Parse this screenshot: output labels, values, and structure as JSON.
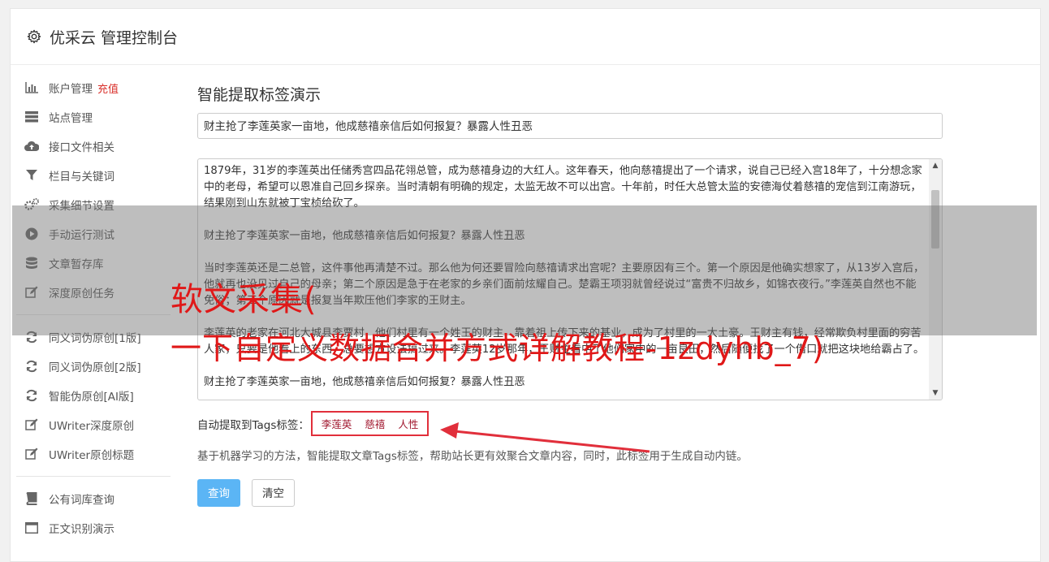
{
  "header": {
    "title": "优采云 管理控制台"
  },
  "sidebar": {
    "group1": [
      {
        "label": "账户管理",
        "badge": "充值",
        "icon": "bar-chart-icon"
      },
      {
        "label": "站点管理",
        "icon": "server-icon"
      },
      {
        "label": "接口文件相关",
        "icon": "cloud-upload-icon"
      },
      {
        "label": "栏目与关键词",
        "icon": "filter-icon"
      },
      {
        "label": "采集细节设置",
        "icon": "gears-icon"
      },
      {
        "label": "手动运行测试",
        "icon": "play-circle-icon"
      },
      {
        "label": "文章暂存库",
        "icon": "database-icon"
      },
      {
        "label": "深度原创任务",
        "icon": "edit-icon"
      }
    ],
    "group2": [
      {
        "label": "同义词伪原创[1版]",
        "icon": "refresh-icon"
      },
      {
        "label": "同义词伪原创[2版]",
        "icon": "refresh-icon"
      },
      {
        "label": "智能伪原创[AI版]",
        "icon": "refresh-icon"
      },
      {
        "label": "UWriter深度原创",
        "icon": "edit-icon"
      },
      {
        "label": "UWriter原创标题",
        "icon": "edit-icon"
      }
    ],
    "group3": [
      {
        "label": "公有词库查询",
        "icon": "book-icon"
      },
      {
        "label": "正文识别演示",
        "icon": "window-icon"
      }
    ]
  },
  "main": {
    "heading": "智能提取标签演示",
    "title_value": "财主抢了李莲英家一亩地，他成慈禧亲信后如何报复？暴露人性丑恶",
    "body_text": "1879年，31岁的李莲英出任储秀宫四品花翎总管，成为慈禧身边的大红人。这年春天，他向慈禧提出了一个请求，说自己已经入宫18年了，十分想念家中的老母，希望可以恩准自己回乡探亲。当时清朝有明确的规定，太监无故不可以出宫。十年前，时任大总管太监的安德海仗着慈禧的宠信到江南游玩，结果刚到山东就被丁宝桢给砍了。\n\n财主抢了李莲英家一亩地，他成慈禧亲信后如何报复？暴露人性丑恶\n\n当时李莲英还是二总管，这件事他再清楚不过。那么他为何还要冒险向慈禧请求出宫呢？主要原因有三个。第一个原因是他确实想家了，从13岁入宫后，他就再也没见过自己的母亲；第二个原因是急于在老家的乡亲们面前炫耀自己。楚霸王项羽就曾经说过“富贵不归故乡，如锦衣夜行。”李莲英自然也不能免俗；第三个原因就是报复当年欺压他们李家的王财主。\n\n李莲英的老家在河北大城县李贾村，他们村里有一个姓王的财主，靠着祖上传下来的基业，成为了村里的一大土豪。王财主有钱，经常欺负村里面的穷苦人家，只要是他看上的东西，总要想方设法搞过来。李莲英12岁那年，王财主看中了他们家中的一亩良田，然后随便找了一个借口就把这块地给霸占了。\n\n财主抢了李莲英家一亩地，他成慈禧亲信后如何报复？暴露人性丑恶",
    "tags_label": "自动提取到Tags标签：",
    "tags": [
      "李莲英",
      "慈禧",
      "人性"
    ],
    "description": "基于机器学习的方法，智能提取文章Tags标签，帮助站长更有效聚合文章内容，同时，此标签用于生成自动内链。",
    "query_button": "查询",
    "clear_button": "清空"
  },
  "watermark": {
    "line1": "软文采集(",
    "line2": "一下自定义数据合并方式详解教程-1zdyhb_7)"
  },
  "colors": {
    "accent": "#5bb5f5",
    "badge": "#d9302b",
    "highlight": "#e12f3b"
  }
}
